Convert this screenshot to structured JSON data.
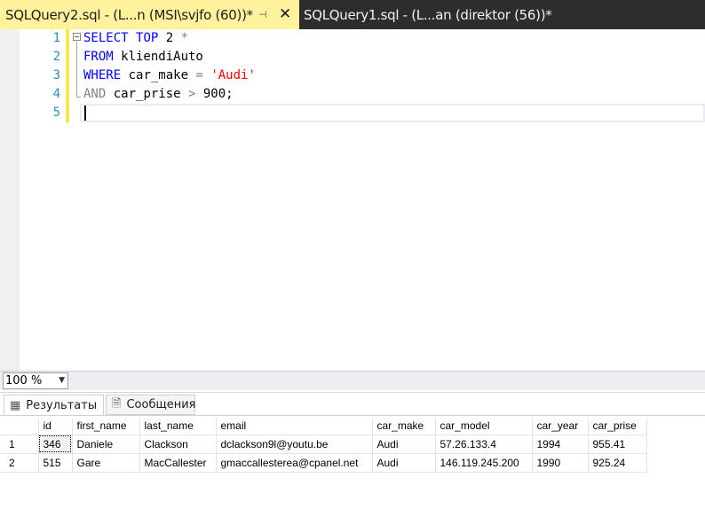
{
  "tabs": [
    {
      "label": "SQLQuery2.sql - (L...n (MSI\\svjfo (60))*",
      "active": true,
      "pin_icon": "pin-icon",
      "close_icon": "close-icon",
      "pin_glyph": "⊣",
      "close_glyph": "✕"
    },
    {
      "label": "SQLQuery1.sql - (L...an (direktor (56))*",
      "active": false
    }
  ],
  "editor": {
    "line_numbers": [
      "1",
      "2",
      "3",
      "4",
      "5"
    ],
    "lines": [
      [
        {
          "t": "SELECT",
          "c": "kw"
        },
        {
          "t": " ",
          "c": ""
        },
        {
          "t": "TOP",
          "c": "kw"
        },
        {
          "t": " 2 ",
          "c": ""
        },
        {
          "t": "*",
          "c": "op"
        }
      ],
      [
        {
          "t": "FROM",
          "c": "kw"
        },
        {
          "t": " kliendiAuto",
          "c": ""
        }
      ],
      [
        {
          "t": "WHERE",
          "c": "kw"
        },
        {
          "t": " car_make ",
          "c": ""
        },
        {
          "t": "=",
          "c": "op"
        },
        {
          "t": " ",
          "c": ""
        },
        {
          "t": "'Audi'",
          "c": "str"
        }
      ],
      [
        {
          "t": "AND",
          "c": "op"
        },
        {
          "t": " car_prise ",
          "c": ""
        },
        {
          "t": ">",
          "c": "op"
        },
        {
          "t": " 900;",
          "c": ""
        }
      ],
      []
    ]
  },
  "zoom": {
    "value": "100 %",
    "arrow": "▼"
  },
  "result_tabs": [
    {
      "label": "Результаты",
      "icon": "grid-icon",
      "glyph": "▦"
    },
    {
      "label": "Сообщения",
      "icon": "message-icon",
      "glyph": "🗎"
    }
  ],
  "grid": {
    "columns": [
      "id",
      "first_name",
      "last_name",
      "email",
      "car_make",
      "car_model",
      "car_year",
      "car_prise"
    ],
    "rows": [
      {
        "num": "1",
        "cells": [
          "346",
          "Daniele",
          "Clackson",
          "dclackson9l@youtu.be",
          "Audi",
          "57.26.133.4",
          "1994",
          "955.41"
        ]
      },
      {
        "num": "2",
        "cells": [
          "515",
          "Gare",
          "MacCallester",
          "gmaccallesterea@cpanel.net",
          "Audi",
          "146.119.245.200",
          "1990",
          "925.24"
        ]
      }
    ]
  }
}
